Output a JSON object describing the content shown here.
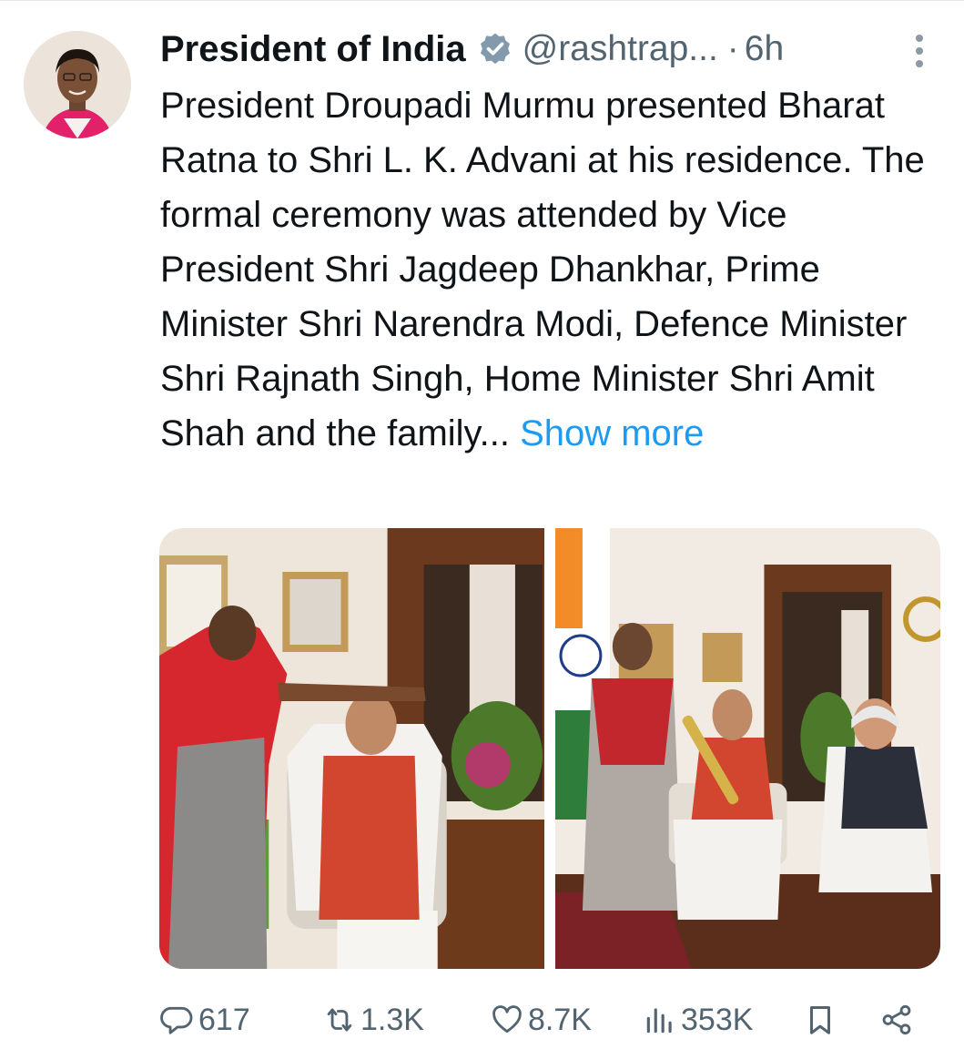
{
  "tweet": {
    "author_name": "President of India",
    "handle": "@rashtrap...",
    "separator": "·",
    "time": "6h",
    "body": "President Droupadi Murmu presented Bharat Ratna to Shri L. K. Advani at his residence. The formal ceremony was attended by Vice President Shri Jagdeep Dhankhar, Prime Minister Shri Narendra Modi, Defence Minister Shri Rajnath Singh, Home Minister Shri Amit Shah and the family...",
    "show_more": "Show more"
  },
  "stats": {
    "replies": "617",
    "reposts": "1.3K",
    "likes": "8.7K",
    "views": "353K"
  },
  "icons": {
    "verified": "verified-badge-icon",
    "more": "more-vertical-icon",
    "reply": "reply-icon",
    "repost": "repost-icon",
    "like": "heart-icon",
    "views": "views-icon",
    "bookmark": "bookmark-icon",
    "share": "share-icon"
  },
  "colors": {
    "link": "#1d9bf0",
    "secondary_text": "#536471",
    "primary_text": "#0f1419"
  }
}
